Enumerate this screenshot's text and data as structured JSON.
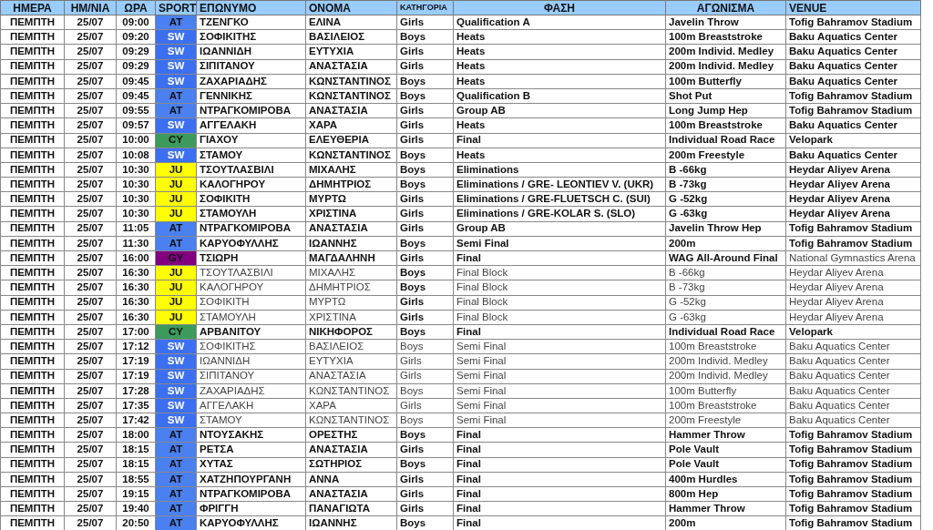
{
  "table": {
    "columns": [
      "ΗΜΕΡΑ",
      "ΗΜ/ΝΙΑ",
      "ΩΡΑ",
      "SPORT",
      "ΕΠΩΝΥΜΟ",
      "ΟΝΟΜΑ",
      "ΚΑΤΗΓΟΡΙΑ",
      "ΦΑΣΗ",
      "ΑΓΩΝΙΣΜΑ",
      "VENUE"
    ],
    "rows": [
      {
        "day": "ΠΕΜΠΤΗ",
        "date": "25/07",
        "time": "09:00",
        "sport": "AT",
        "color": "#4a80f0",
        "light_label": false,
        "surname": "ΤΖΕΝΓΚΟ",
        "name": "ΕΛΙΝΑ",
        "category": "Girls",
        "phase": "Qualification A",
        "event": "Javelin Throw",
        "venue": "Tofig Bahramov Stadium",
        "bold_names": true,
        "bold_category": true,
        "bold_phase": true,
        "bold_event": true,
        "bold_venue": true
      },
      {
        "day": "ΠΕΜΠΤΗ",
        "date": "25/07",
        "time": "09:20",
        "sport": "SW",
        "color": "#3d70f0",
        "light_label": true,
        "surname": "ΣΟΦΙΚΙΤΗΣ",
        "name": "ΒΑΣΙΛΕΙΟΣ",
        "category": "Boys",
        "phase": "Heats",
        "event": "100m Breaststroke",
        "venue": "Baku Aquatics Center",
        "bold_names": true,
        "bold_category": true,
        "bold_phase": true,
        "bold_event": true,
        "bold_venue": true
      },
      {
        "day": "ΠΕΜΠΤΗ",
        "date": "25/07",
        "time": "09:29",
        "sport": "SW",
        "color": "#3d70f0",
        "light_label": true,
        "surname": "ΙΩΑΝΝΙΔΗ",
        "name": "ΕΥΤΥΧΙΑ",
        "category": "Girls",
        "phase": "Heats",
        "event": "200m Individ. Medley",
        "venue": "Baku Aquatics Center",
        "bold_names": true,
        "bold_category": true,
        "bold_phase": true,
        "bold_event": true,
        "bold_venue": true
      },
      {
        "day": "ΠΕΜΠΤΗ",
        "date": "25/07",
        "time": "09:29",
        "sport": "SW",
        "color": "#3d70f0",
        "light_label": true,
        "surname": "ΣΙΠΙΤΑΝΟΥ",
        "name": "ΑΝΑΣΤΑΣΙΑ",
        "category": "Girls",
        "phase": "Heats",
        "event": "200m Individ. Medley",
        "venue": "Baku Aquatics Center",
        "bold_names": true,
        "bold_category": true,
        "bold_phase": true,
        "bold_event": true,
        "bold_venue": true
      },
      {
        "day": "ΠΕΜΠΤΗ",
        "date": "25/07",
        "time": "09:45",
        "sport": "SW",
        "color": "#3d70f0",
        "light_label": true,
        "surname": "ΖΑΧΑΡΙΑΔΗΣ",
        "name": "ΚΩΝΣΤΑΝΤΙΝΟΣ",
        "category": "Boys",
        "phase": "Heats",
        "event": "100m Butterfly",
        "venue": "Baku Aquatics Center",
        "bold_names": true,
        "bold_category": true,
        "bold_phase": true,
        "bold_event": true,
        "bold_venue": true
      },
      {
        "day": "ΠΕΜΠΤΗ",
        "date": "25/07",
        "time": "09:45",
        "sport": "AT",
        "color": "#4a80f0",
        "light_label": false,
        "surname": "ΓΕΝΝΙΚΗΣ",
        "name": "ΚΩΝΣΤΑΝΤΙΝΟΣ",
        "category": "Boys",
        "phase": "Qualification B",
        "event": "Shot Put",
        "venue": "Tofig Bahramov Stadium",
        "bold_names": true,
        "bold_category": true,
        "bold_phase": true,
        "bold_event": true,
        "bold_venue": true
      },
      {
        "day": "ΠΕΜΠΤΗ",
        "date": "25/07",
        "time": "09:55",
        "sport": "AT",
        "color": "#4a80f0",
        "light_label": false,
        "surname": "ΝΤΡΑΓΚΟΜΙΡΟΒΑ",
        "name": "ΑΝΑΣΤΑΣΙΑ",
        "category": "Girls",
        "phase": "Group AB",
        "event": "Long Jump Hep",
        "venue": "Tofig Bahramov Stadium",
        "bold_names": true,
        "bold_category": true,
        "bold_phase": true,
        "bold_event": true,
        "bold_venue": true
      },
      {
        "day": "ΠΕΜΠΤΗ",
        "date": "25/07",
        "time": "09:57",
        "sport": "SW",
        "color": "#3d70f0",
        "light_label": true,
        "surname": "ΑΓΓΕΛΑΚΗ",
        "name": "ΧΑΡΑ",
        "category": "Girls",
        "phase": "Heats",
        "event": "100m Breaststroke",
        "venue": "Baku Aquatics Center",
        "bold_names": true,
        "bold_category": true,
        "bold_phase": true,
        "bold_event": true,
        "bold_venue": true
      },
      {
        "day": "ΠΕΜΠΤΗ",
        "date": "25/07",
        "time": "10:00",
        "sport": "CY",
        "color": "#3c9a5c",
        "light_label": false,
        "surname": "ΓΙΑΧΟΥ",
        "name": "ΕΛΕΥΘΕΡΙΑ",
        "category": "Girls",
        "phase": "Final",
        "event": "Individual Road Race",
        "venue": "Velopark",
        "bold_names": true,
        "bold_category": true,
        "bold_phase": true,
        "bold_event": true,
        "bold_venue": true
      },
      {
        "day": "ΠΕΜΠΤΗ",
        "date": "25/07",
        "time": "10:08",
        "sport": "SW",
        "color": "#3d70f0",
        "light_label": true,
        "surname": "ΣΤΑΜΟΥ",
        "name": "ΚΩΝΣΤΑΝΤΙΝΟΣ",
        "category": "Boys",
        "phase": "Heats",
        "event": "200m Freestyle",
        "venue": "Baku Aquatics Center",
        "bold_names": true,
        "bold_category": true,
        "bold_phase": true,
        "bold_event": true,
        "bold_venue": true
      },
      {
        "day": "ΠΕΜΠΤΗ",
        "date": "25/07",
        "time": "10:30",
        "sport": "JU",
        "color": "#ffff00",
        "light_label": false,
        "surname": "ΤΣΟΥΤΛΑΣΒΙΛΙ",
        "name": "ΜΙΧΑΛΗΣ",
        "category": "Boys",
        "phase": "Eliminations",
        "event": "B -66kg",
        "venue": "Heydar Aliyev Arena",
        "bold_names": true,
        "bold_category": true,
        "bold_phase": true,
        "bold_event": true,
        "bold_venue": true
      },
      {
        "day": "ΠΕΜΠΤΗ",
        "date": "25/07",
        "time": "10:30",
        "sport": "JU",
        "color": "#ffff00",
        "light_label": false,
        "surname": "ΚΑΛΟΓΗΡΟΥ",
        "name": "ΔΗΜΗΤΡΙΟΣ",
        "category": "Boys",
        "phase": "Eliminations / GRE- LEONTIEV V. (UKR)",
        "event": "B -73kg",
        "venue": "Heydar Aliyev Arena",
        "bold_names": true,
        "bold_category": true,
        "bold_phase": true,
        "bold_event": true,
        "bold_venue": true
      },
      {
        "day": "ΠΕΜΠΤΗ",
        "date": "25/07",
        "time": "10:30",
        "sport": "JU",
        "color": "#ffff00",
        "light_label": false,
        "surname": "ΣΟΦΙΚΙΤΗ",
        "name": "ΜΥΡΤΩ",
        "category": "Girls",
        "phase": "Eliminations / GRE-FLUETSCH C. (SUI)",
        "event": "G -52kg",
        "venue": "Heydar Aliyev Arena",
        "bold_names": true,
        "bold_category": true,
        "bold_phase": true,
        "bold_event": true,
        "bold_venue": true
      },
      {
        "day": "ΠΕΜΠΤΗ",
        "date": "25/07",
        "time": "10:30",
        "sport": "JU",
        "color": "#ffff00",
        "light_label": false,
        "surname": "ΣΤΑΜΟΥΛΗ",
        "name": "ΧΡΙΣΤΙΝΑ",
        "category": "Girls",
        "phase": "Eliminations / GRE-KOLAR S. (SLO)",
        "event": "G -63kg",
        "venue": "Heydar Aliyev Arena",
        "bold_names": true,
        "bold_category": true,
        "bold_phase": true,
        "bold_event": true,
        "bold_venue": true
      },
      {
        "day": "ΠΕΜΠΤΗ",
        "date": "25/07",
        "time": "11:05",
        "sport": "AT",
        "color": "#4a80f0",
        "light_label": false,
        "surname": "ΝΤΡΑΓΚΟΜΙΡΟΒΑ",
        "name": "ΑΝΑΣΤΑΣΙΑ",
        "category": "Girls",
        "phase": "Group AB",
        "event": "Javelin Throw Hep",
        "venue": "Tofig Bahramov Stadium",
        "bold_names": true,
        "bold_category": true,
        "bold_phase": true,
        "bold_event": true,
        "bold_venue": true
      },
      {
        "day": "ΠΕΜΠΤΗ",
        "date": "25/07",
        "time": "11:30",
        "sport": "AT",
        "color": "#4a80f0",
        "light_label": false,
        "surname": "ΚΑΡΥΟΦΥΛΛΗΣ",
        "name": "ΙΩΑΝΝΗΣ",
        "category": "Boys",
        "phase": "Semi Final",
        "event": "200m",
        "venue": "Tofig Bahramov Stadium",
        "bold_names": true,
        "bold_category": true,
        "bold_phase": true,
        "bold_event": true,
        "bold_venue": true
      },
      {
        "day": "ΠΕΜΠΤΗ",
        "date": "25/07",
        "time": "16:00",
        "sport": "GY",
        "color": "#800080",
        "light_label": false,
        "surname": "ΤΣΙΩΡΗ",
        "name": "ΜΑΓΔΑΛΗΝΗ",
        "category": "Girls",
        "phase": "Final",
        "event": "WAG All-Around Final",
        "venue": "National Gymnastics Arena",
        "bold_names": true,
        "bold_category": true,
        "bold_phase": true,
        "bold_event": true,
        "bold_venue": false
      },
      {
        "day": "ΠΕΜΠΤΗ",
        "date": "25/07",
        "time": "16:30",
        "sport": "JU",
        "color": "#ffff00",
        "light_label": false,
        "surname": "ΤΣΟΥΤΛΑΣΒΙΛΙ",
        "name": "ΜΙΧΑΛΗΣ",
        "category": "Boys",
        "phase": "Final Block",
        "event": "B -66kg",
        "venue": "Heydar Aliyev Arena",
        "bold_names": false,
        "bold_category": true,
        "bold_phase": false,
        "bold_event": false,
        "bold_venue": false
      },
      {
        "day": "ΠΕΜΠΤΗ",
        "date": "25/07",
        "time": "16:30",
        "sport": "JU",
        "color": "#ffff00",
        "light_label": false,
        "surname": "ΚΑΛΟΓΗΡΟΥ",
        "name": "ΔΗΜΗΤΡΙΟΣ",
        "category": "Boys",
        "phase": "Final Block",
        "event": "B -73kg",
        "venue": "Heydar Aliyev Arena",
        "bold_names": false,
        "bold_category": true,
        "bold_phase": false,
        "bold_event": false,
        "bold_venue": false
      },
      {
        "day": "ΠΕΜΠΤΗ",
        "date": "25/07",
        "time": "16:30",
        "sport": "JU",
        "color": "#ffff00",
        "light_label": false,
        "surname": "ΣΟΦΙΚΙΤΗ",
        "name": "ΜΥΡΤΩ",
        "category": "Girls",
        "phase": "Final Block",
        "event": "G -52kg",
        "venue": "Heydar Aliyev Arena",
        "bold_names": false,
        "bold_category": true,
        "bold_phase": false,
        "bold_event": false,
        "bold_venue": false
      },
      {
        "day": "ΠΕΜΠΤΗ",
        "date": "25/07",
        "time": "16:30",
        "sport": "JU",
        "color": "#ffff00",
        "light_label": false,
        "surname": "ΣΤΑΜΟΥΛΗ",
        "name": "ΧΡΙΣΤΙΝΑ",
        "category": "Girls",
        "phase": "Final Block",
        "event": "G -63kg",
        "venue": "Heydar Aliyev Arena",
        "bold_names": false,
        "bold_category": true,
        "bold_phase": false,
        "bold_event": false,
        "bold_venue": false
      },
      {
        "day": "ΠΕΜΠΤΗ",
        "date": "25/07",
        "time": "17:00",
        "sport": "CY",
        "color": "#3c9a5c",
        "light_label": false,
        "surname": "ΑΡΒΑΝΙΤΟΥ",
        "name": "ΝΙΚΗΦΟΡΟΣ",
        "category": "Boys",
        "phase": "Final",
        "event": "Individual Road Race",
        "venue": "Velopark",
        "bold_names": true,
        "bold_category": true,
        "bold_phase": true,
        "bold_event": true,
        "bold_venue": true
      },
      {
        "day": "ΠΕΜΠΤΗ",
        "date": "25/07",
        "time": "17:12",
        "sport": "SW",
        "color": "#3d70f0",
        "light_label": true,
        "surname": "ΣΟΦΙΚΙΤΗΣ",
        "name": "ΒΑΣΙΛΕΙΟΣ",
        "category": "Boys",
        "phase": "Semi Final",
        "event": "100m Breaststroke",
        "venue": "Baku Aquatics Center",
        "bold_names": false,
        "bold_category": false,
        "bold_phase": false,
        "bold_event": false,
        "bold_venue": false
      },
      {
        "day": "ΠΕΜΠΤΗ",
        "date": "25/07",
        "time": "17:19",
        "sport": "SW",
        "color": "#3d70f0",
        "light_label": true,
        "surname": "ΙΩΑΝΝΙΔΗ",
        "name": "ΕΥΤΥΧΙΑ",
        "category": "Girls",
        "phase": "Semi Final",
        "event": "200m Individ. Medley",
        "venue": "Baku Aquatics Center",
        "bold_names": false,
        "bold_category": false,
        "bold_phase": false,
        "bold_event": false,
        "bold_venue": false
      },
      {
        "day": "ΠΕΜΠΤΗ",
        "date": "25/07",
        "time": "17:19",
        "sport": "SW",
        "color": "#3d70f0",
        "light_label": true,
        "surname": "ΣΙΠΙΤΑΝΟΥ",
        "name": "ΑΝΑΣΤΑΣΙΑ",
        "category": "Girls",
        "phase": "Semi Final",
        "event": "200m Individ. Medley",
        "venue": "Baku Aquatics Center",
        "bold_names": false,
        "bold_category": false,
        "bold_phase": false,
        "bold_event": false,
        "bold_venue": false
      },
      {
        "day": "ΠΕΜΠΤΗ",
        "date": "25/07",
        "time": "17:28",
        "sport": "SW",
        "color": "#3d70f0",
        "light_label": true,
        "surname": "ΖΑΧΑΡΙΑΔΗΣ",
        "name": "ΚΩΝΣΤΑΝΤΙΝΟΣ",
        "category": "Boys",
        "phase": "Semi Final",
        "event": "100m Butterfly",
        "venue": "Baku Aquatics Center",
        "bold_names": false,
        "bold_category": false,
        "bold_phase": false,
        "bold_event": false,
        "bold_venue": false
      },
      {
        "day": "ΠΕΜΠΤΗ",
        "date": "25/07",
        "time": "17:35",
        "sport": "SW",
        "color": "#3d70f0",
        "light_label": true,
        "surname": "ΑΓΓΕΛΑΚΗ",
        "name": "ΧΑΡΑ",
        "category": "Girls",
        "phase": "Semi Final",
        "event": "100m Breaststroke",
        "venue": "Baku Aquatics Center",
        "bold_names": false,
        "bold_category": false,
        "bold_phase": false,
        "bold_event": false,
        "bold_venue": false
      },
      {
        "day": "ΠΕΜΠΤΗ",
        "date": "25/07",
        "time": "17:42",
        "sport": "SW",
        "color": "#3d70f0",
        "light_label": true,
        "surname": "ΣΤΑΜΟΥ",
        "name": "ΚΩΝΣΤΑΝΤΙΝΟΣ",
        "category": "Boys",
        "phase": "Semi Final",
        "event": "200m Freestyle",
        "venue": "Baku Aquatics Center",
        "bold_names": false,
        "bold_category": false,
        "bold_phase": false,
        "bold_event": false,
        "bold_venue": false
      },
      {
        "day": "ΠΕΜΠΤΗ",
        "date": "25/07",
        "time": "18:00",
        "sport": "AT",
        "color": "#4a80f0",
        "light_label": false,
        "surname": "ΝΤΟΥΣΑΚΗΣ",
        "name": "ΟΡΕΣΤΗΣ",
        "category": "Boys",
        "phase": "Final",
        "event": "Hammer Throw",
        "venue": "Tofig Bahramov Stadium",
        "bold_names": true,
        "bold_category": true,
        "bold_phase": true,
        "bold_event": true,
        "bold_venue": true
      },
      {
        "day": "ΠΕΜΠΤΗ",
        "date": "25/07",
        "time": "18:15",
        "sport": "AT",
        "color": "#4a80f0",
        "light_label": false,
        "surname": "ΡΕΤΣΑ",
        "name": "ΑΝΑΣΤΑΣΙΑ",
        "category": "Girls",
        "phase": "Final",
        "event": "Pole Vault",
        "venue": "Tofig Bahramov Stadium",
        "bold_names": true,
        "bold_category": true,
        "bold_phase": true,
        "bold_event": true,
        "bold_venue": true
      },
      {
        "day": "ΠΕΜΠΤΗ",
        "date": "25/07",
        "time": "18:15",
        "sport": "AT",
        "color": "#4a80f0",
        "light_label": false,
        "surname": "ΧΥΤΑΣ",
        "name": "ΣΩΤΗΡΙΟΣ",
        "category": "Boys",
        "phase": "Final",
        "event": "Pole Vault",
        "venue": "Tofig Bahramov Stadium",
        "bold_names": true,
        "bold_category": true,
        "bold_phase": true,
        "bold_event": true,
        "bold_venue": true
      },
      {
        "day": "ΠΕΜΠΤΗ",
        "date": "25/07",
        "time": "18:55",
        "sport": "AT",
        "color": "#4a80f0",
        "light_label": false,
        "surname": "ΧΑΤΖΗΠΟΥΡΓΑΝΗ",
        "name": "ΑΝΝΑ",
        "category": "Girls",
        "phase": "Final",
        "event": "400m Hurdles",
        "venue": "Tofig Bahramov Stadium",
        "bold_names": true,
        "bold_category": true,
        "bold_phase": true,
        "bold_event": true,
        "bold_venue": true
      },
      {
        "day": "ΠΕΜΠΤΗ",
        "date": "25/07",
        "time": "19:15",
        "sport": "AT",
        "color": "#4a80f0",
        "light_label": false,
        "surname": "ΝΤΡΑΓΚΟΜΙΡΟΒΑ",
        "name": "ΑΝΑΣΤΑΣΙΑ",
        "category": "Girls",
        "phase": "Final",
        "event": "800m Hep",
        "venue": "Tofig Bahramov Stadium",
        "bold_names": true,
        "bold_category": true,
        "bold_phase": true,
        "bold_event": true,
        "bold_venue": true
      },
      {
        "day": "ΠΕΜΠΤΗ",
        "date": "25/07",
        "time": "19:40",
        "sport": "AT",
        "color": "#4a80f0",
        "light_label": false,
        "surname": "ΦΡΙΓΓΗ",
        "name": "ΠΑΝΑΓΙΩΤΑ",
        "category": "Girls",
        "phase": "Final",
        "event": "Hammer Throw",
        "venue": "Tofig Bahramov Stadium",
        "bold_names": true,
        "bold_category": true,
        "bold_phase": true,
        "bold_event": true,
        "bold_venue": true
      },
      {
        "day": "ΠΕΜΠΤΗ",
        "date": "25/07",
        "time": "20:50",
        "sport": "AT",
        "color": "#4a80f0",
        "light_label": false,
        "surname": "ΚΑΡΥΟΦΥΛΛΗΣ",
        "name": "ΙΩΑΝΝΗΣ",
        "category": "Boys",
        "phase": "Final",
        "event": "200m",
        "venue": "Tofig Bahramov Stadium",
        "bold_names": true,
        "bold_category": true,
        "bold_phase": true,
        "bold_event": true,
        "bold_venue": true
      }
    ]
  }
}
